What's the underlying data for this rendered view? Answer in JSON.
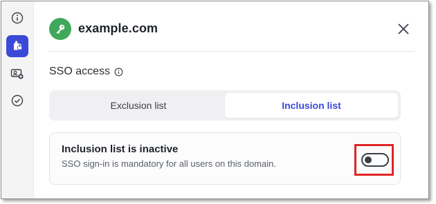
{
  "sidebar": {
    "items": [
      {
        "icon": "info-icon",
        "active": false
      },
      {
        "icon": "user-lock-icon",
        "active": true
      },
      {
        "icon": "id-card-add-icon",
        "active": false
      },
      {
        "icon": "check-circle-icon",
        "active": false
      }
    ]
  },
  "header": {
    "logo_icon": "key-icon",
    "domain": "example.com",
    "close_icon": "close-icon"
  },
  "sso": {
    "title": "SSO access",
    "info_icon": "info-icon",
    "tabs": [
      {
        "label": "Exclusion list",
        "selected": false
      },
      {
        "label": "Inclusion list",
        "selected": true
      }
    ]
  },
  "status_card": {
    "title": "Inclusion list is inactive",
    "description": "SSO sign-in is mandatory for all users on this domain.",
    "toggle_on": false
  },
  "colors": {
    "accent": "#3b49d6",
    "logo_bg": "#3fa85a",
    "highlight": "#e02424"
  }
}
